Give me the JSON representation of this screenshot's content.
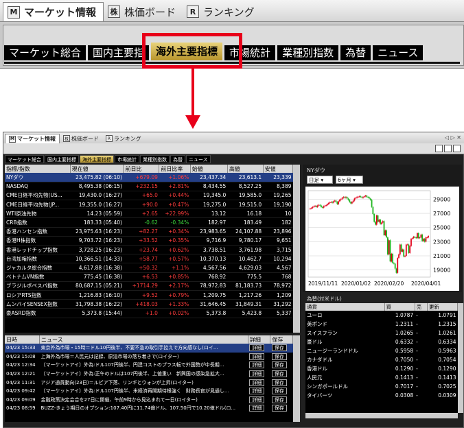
{
  "zoom": {
    "tabs": [
      {
        "icon": "M",
        "label": "マーケット情報"
      },
      {
        "icon": "株",
        "label": "株価ボード"
      },
      {
        "icon": "R",
        "label": "ランキング"
      }
    ],
    "subtabs": [
      "マーケット総合",
      "国内主要指",
      "海外主要指標",
      "市場統計",
      "業種別指数",
      "為替",
      "ニュース"
    ]
  },
  "app": {
    "tabs": [
      {
        "icon": "M",
        "label": "マーケット情報"
      },
      {
        "icon": "株",
        "label": "株価ボード"
      },
      {
        "icon": "R",
        "label": "ランキング"
      }
    ],
    "subtabs": [
      "マーケット総合",
      "国内主要指標",
      "海外主要指標",
      "市場統計",
      "業種別指数",
      "為替",
      "ニュース"
    ],
    "window_controls": "◁ ▷ ✕"
  },
  "indices": {
    "headers": [
      "指標/指数",
      "現在値",
      "前日比",
      "前日比率",
      "始値",
      "高値",
      "安値"
    ],
    "rows": [
      {
        "name": "NYダウ",
        "price": "23,475.82 (06:10)",
        "chg": "+679.09",
        "pct": "+1.06%",
        "open": "23,437.34",
        "high": "23,613.1",
        "low": "23,339"
      },
      {
        "name": "NASDAQ",
        "price": "8,495.38 (06:15)",
        "chg": "+232.15",
        "pct": "+2.81%",
        "open": "8,434.55",
        "high": "8,527.25",
        "low": "8,389"
      },
      {
        "name": "CME日経平均先物(US...",
        "price": "19,430.0 (16:27)",
        "chg": "+65.0",
        "pct": "+0.44%",
        "open": "19,345.0",
        "high": "19,585.0",
        "low": "19,265"
      },
      {
        "name": "CME日経平均先物(JP...",
        "price": "19,355.0 (16:27)",
        "chg": "+90.0",
        "pct": "+0.47%",
        "open": "19,275.0",
        "high": "19,515.0",
        "low": "19,190"
      },
      {
        "name": "WTI原油先物",
        "price": "14.23 (05:59)",
        "chg": "+2.65",
        "pct": "+22.99%",
        "open": "13.12",
        "high": "16.18",
        "low": "10"
      },
      {
        "name": "CRB指数",
        "price": "183.33 (05:40)",
        "chg": "-0.62",
        "pct": "-0.34%",
        "open": "182.97",
        "high": "183.49",
        "low": "182"
      },
      {
        "name": "香港ハンセン指数",
        "price": "23,975.63 (16:23)",
        "chg": "+82.27",
        "pct": "+0.34%",
        "open": "23,983.65",
        "high": "24,107.88",
        "low": "23,896"
      },
      {
        "name": "香港H株指数",
        "price": "9,703.72 (16:23)",
        "chg": "+33.52",
        "pct": "+0.35%",
        "open": "9,716.9",
        "high": "9,780.17",
        "low": "9,651"
      },
      {
        "name": "香港レッドチップ指数",
        "price": "3,728.25 (16:23)",
        "chg": "+23.74",
        "pct": "+0.62%",
        "open": "3,738.51",
        "high": "3,761.98",
        "low": "3,715"
      },
      {
        "name": "台湾加権指数",
        "price": "10,366.51 (14:33)",
        "chg": "+58.77",
        "pct": "+0.57%",
        "open": "10,370.13",
        "high": "10,462.7",
        "low": "10,294"
      },
      {
        "name": "ジャカルタ総合指数",
        "price": "4,617.88 (16:38)",
        "chg": "+50.32",
        "pct": "+1.1%",
        "open": "4,567.56",
        "high": "4,629.03",
        "low": "4,567"
      },
      {
        "name": "ベトナムVN指数",
        "price": "775.45 (16:38)",
        "chg": "+6.53",
        "pct": "+0.85%",
        "open": "768.92",
        "high": "775.5",
        "low": "768"
      },
      {
        "name": "ブラジルボベスパ指数",
        "price": "80,687.15 (05:21)",
        "chg": "+1714.29",
        "pct": "+2.17%",
        "open": "78,972.83",
        "high": "81,183.73",
        "low": "78,972"
      },
      {
        "name": "ロシアRTS指数",
        "price": "1,216.83 (16:10)",
        "chg": "+9.52",
        "pct": "+0.79%",
        "open": "1,209.75",
        "high": "1,217.26",
        "low": "1,209"
      },
      {
        "name": "ムンバイSENSEX指数",
        "price": "31,798.38 (16:22)",
        "chg": "+418.03",
        "pct": "+1.33%",
        "open": "31,646.45",
        "high": "31,849.31",
        "low": "31,292"
      },
      {
        "name": "豪ASRD指数",
        "price": "5,373.8 (15:44)",
        "chg": "+1.0",
        "pct": "+0.02%",
        "open": "5,373.8",
        "high": "5,423.8",
        "low": "5,337"
      }
    ]
  },
  "news": {
    "headers": [
      "日時",
      "ニュース",
      "詳細",
      "保存"
    ],
    "detail_label": "詳細",
    "save_label": "保存",
    "rows": [
      {
        "time": "04/23 15:33",
        "text": "東京外為市場・15時＝ドル10円後半、不要不急の取引手控えで方向感なし(ロイ..."
      },
      {
        "time": "04/23 15:08",
        "text": "上海外為市場＝人民元は記録、原油市場の落ち着きで(ロイター)"
      },
      {
        "time": "04/23 12:34",
        "text": "〔マーケットアイ〕外為:ドル107円後半、円建コストのプラス転で外国勢が中長期..."
      },
      {
        "time": "04/23 12:21",
        "text": "〔マーケットアイ〕外為:正午のドルは107円後半、上値重い　新興国の感染急拡大..."
      },
      {
        "time": "04/23 11:31",
        "text": "アジア通貨動向(23日)＝ルピア下落、リンギとウォンが上昇(ロイター)"
      },
      {
        "time": "04/23 09:42",
        "text": "〔マーケットアイ〕外為:ドル107円後半、米経済再開期待根強く　財務長官が見通し..."
      },
      {
        "time": "04/23 09:09",
        "text": "金融政策決定会合を27日に開催、午前9時から見込まれて一日(ロイター)"
      },
      {
        "time": "04/23 08:59",
        "text": "BUZZ-きょう期日のオプション:107.40円に11.74億ドル、107.50円で10.20億ドル(ロ..."
      }
    ]
  },
  "chart": {
    "title": "NYダウ",
    "period_label": "日足",
    "range_label": "6ヶ月"
  },
  "chart_data": {
    "type": "candlestick",
    "title": "NYダウ",
    "x_ticks": [
      "2019/11/11",
      "2020/01/02",
      "2020/02/20",
      "2020/04/01"
    ],
    "y_ticks": [
      19000,
      21000,
      23000,
      25000,
      27000,
      29000
    ],
    "ylim": [
      18000,
      30200
    ],
    "close": [
      27680,
      27750,
      27900,
      28000,
      28050,
      27900,
      28100,
      28200,
      28100,
      27900,
      27800,
      28000,
      28100,
      28150,
      28300,
      28450,
      28550,
      28600,
      28500,
      28700,
      28800,
      28600,
      28300,
      28700,
      28900,
      29000,
      29200,
      29300,
      29200,
      29300,
      29100,
      28900,
      28600,
      28400,
      28600,
      28800,
      29100,
      29200,
      29300,
      29350,
      29400,
      29300,
      29200,
      29300,
      29400,
      29500,
      29300,
      29250,
      29100,
      28900,
      27900,
      26900,
      25800,
      25400,
      26700,
      25800,
      26100,
      25500,
      25700,
      25900,
      23900,
      24600,
      23600,
      21200,
      23200,
      20200,
      21300,
      20000,
      19900,
      19200,
      18600,
      20700,
      21200,
      22600,
      21600,
      21900,
      20900,
      21000,
      22600,
      22600,
      21400,
      22400,
      23400,
      23500,
      23700,
      23600,
      23500,
      24200,
      23500,
      23600,
      24000,
      23100,
      23400,
      23000,
      23600,
      23600,
      23800
    ],
    "up_color": "#e2001a",
    "down_color": "#1db51d"
  },
  "fx": {
    "label": "為替(対米ドル)",
    "headers": [
      "通貨",
      "買",
      "売",
      "更新"
    ],
    "rows": [
      {
        "name": "ユーロ",
        "buy": "1.0787",
        "dash": "-",
        "sell": "1.0791"
      },
      {
        "name": "英ポンド",
        "buy": "1.2311",
        "dash": "-",
        "sell": "1.2315"
      },
      {
        "name": "スイスフラン",
        "buy": "1.0265",
        "dash": "-",
        "sell": "1.0261"
      },
      {
        "name": "豪ドル",
        "buy": "0.6332",
        "dash": "-",
        "sell": "0.6334"
      },
      {
        "name": "ニュージーランドドル",
        "buy": "0.5958",
        "dash": "-",
        "sell": "0.5963"
      },
      {
        "name": "カナダドル",
        "buy": "0.7050",
        "dash": "-",
        "sell": "0.7054"
      },
      {
        "name": "香港ドル",
        "buy": "0.1290",
        "dash": "-",
        "sell": "0.1290"
      },
      {
        "name": "人民元",
        "buy": "0.1413",
        "dash": "-",
        "sell": "0.1413"
      },
      {
        "name": "シンガポールドル",
        "buy": "0.7017",
        "dash": "-",
        "sell": "0.7025"
      },
      {
        "name": "タイバーツ",
        "buy": "0.0308",
        "dash": "-",
        "sell": "0.0309"
      }
    ]
  }
}
